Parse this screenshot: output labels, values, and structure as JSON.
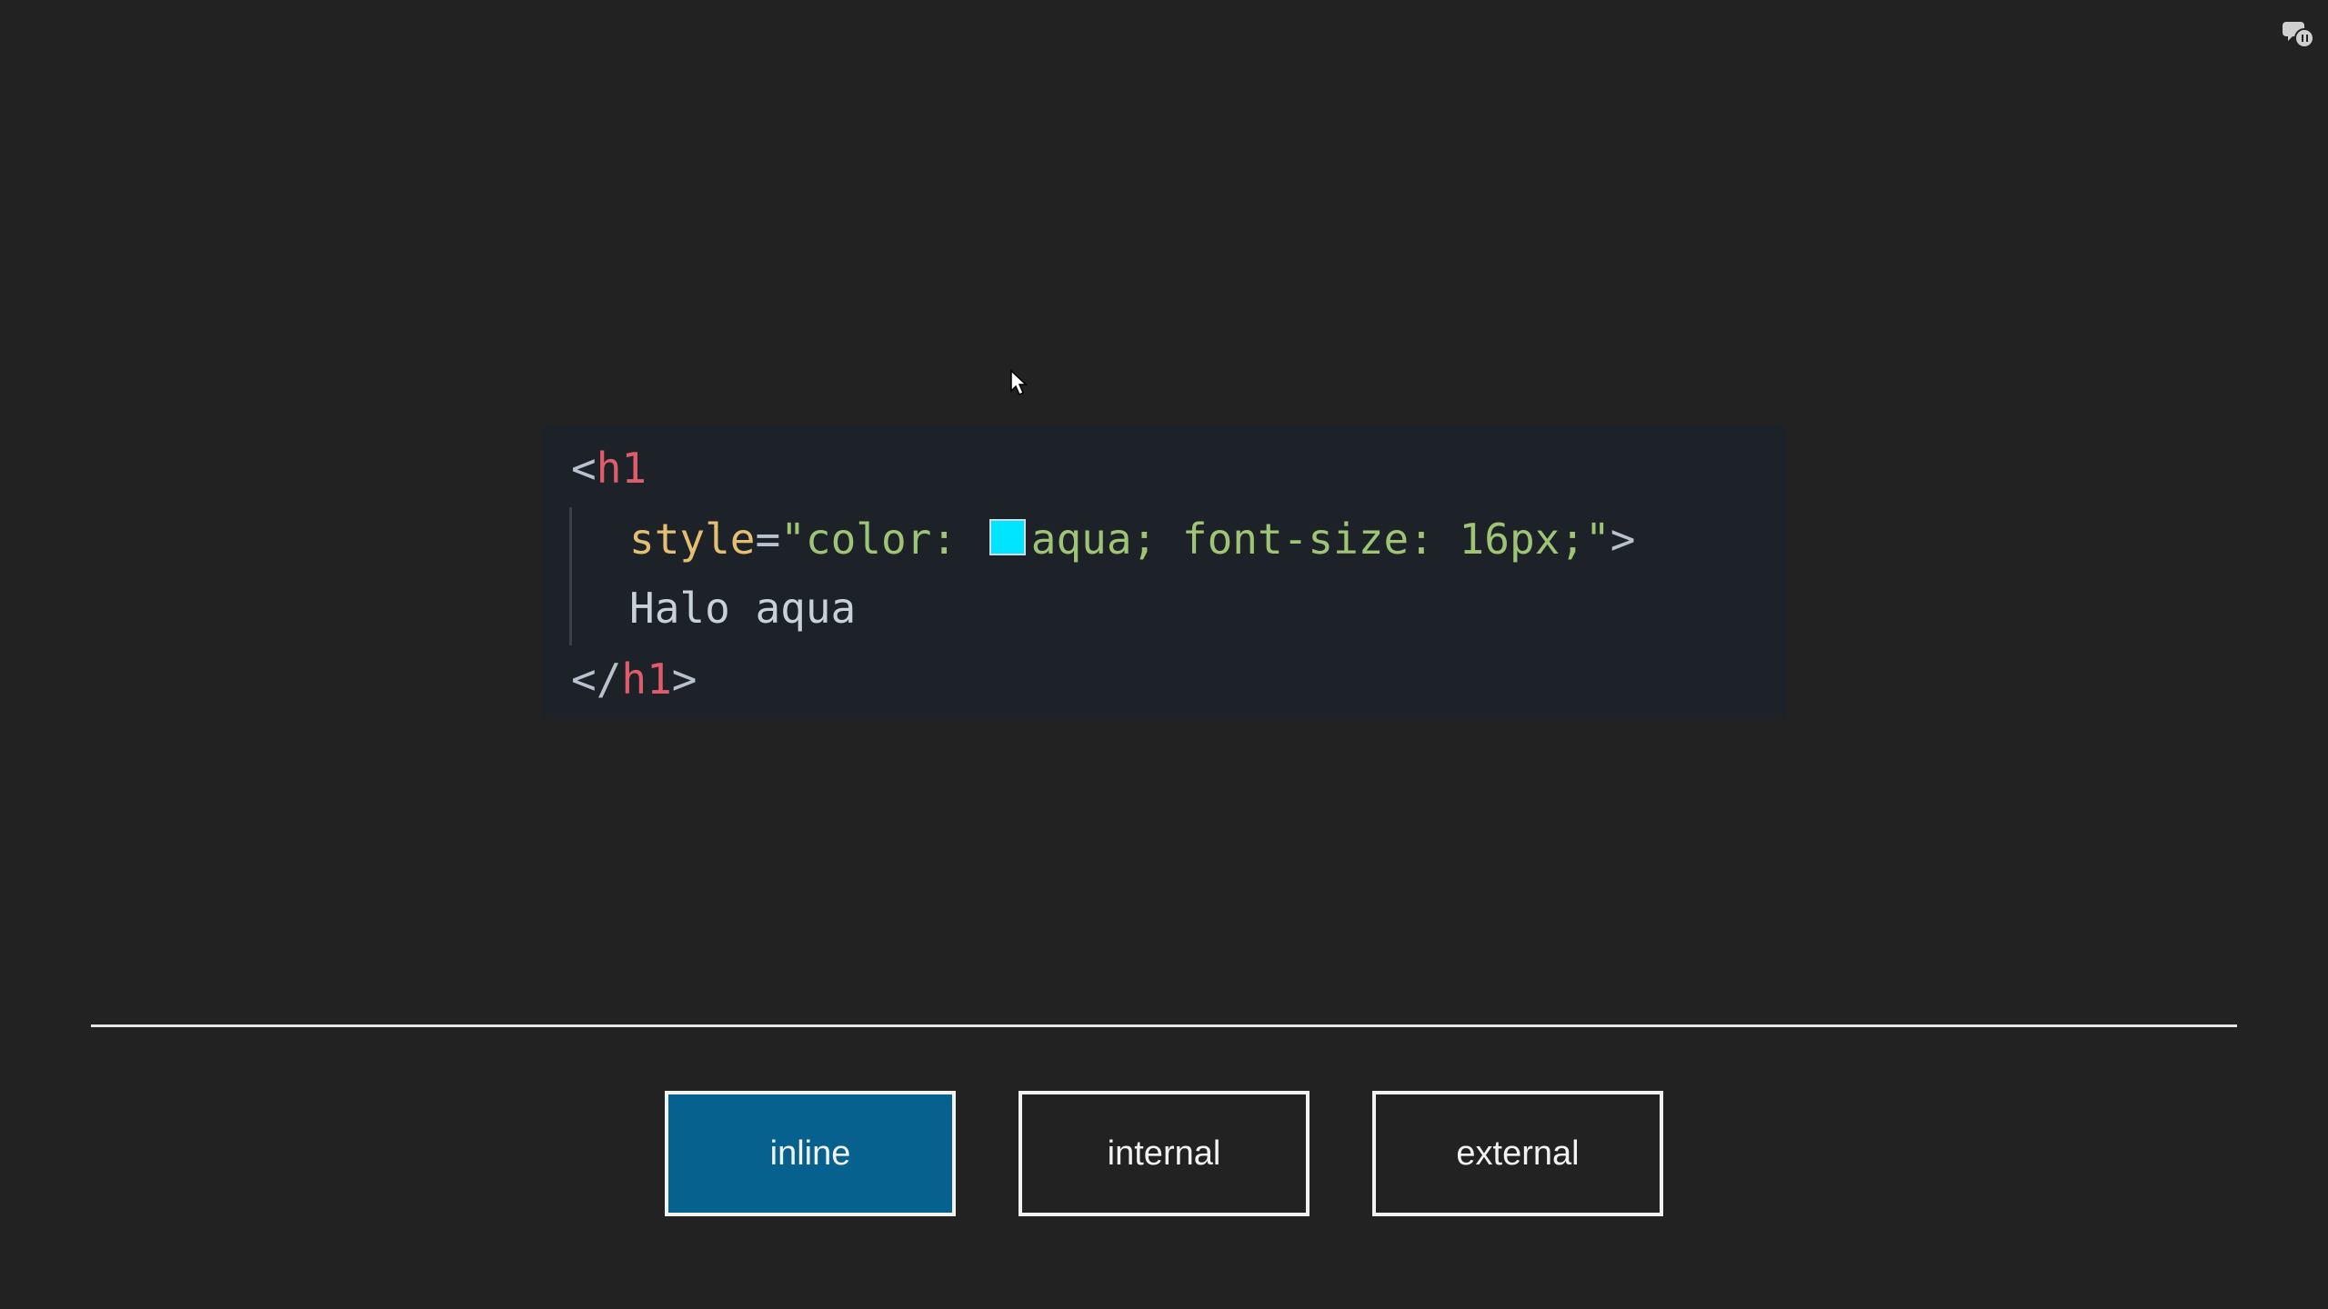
{
  "code": {
    "line1": {
      "open": "<",
      "tag": "h1"
    },
    "line2": {
      "attr": "style",
      "eq": "=",
      "value_start": "\"color: ",
      "value_rest": "aqua; font-size: 16px;\"",
      "close": ">"
    },
    "line3": {
      "text": "Halo aqua"
    },
    "line4": {
      "open": "</",
      "tag": "h1",
      "close": ">"
    },
    "swatch_color": "#00e5ff"
  },
  "tabs": [
    {
      "label": "inline",
      "active": true
    },
    {
      "label": "internal",
      "active": false
    },
    {
      "label": "external",
      "active": false
    }
  ],
  "colors": {
    "background": "#222222",
    "code_background": "#1c2228",
    "tag": "#e05c6c",
    "attribute": "#e4bf73",
    "string": "#9fc475",
    "active_tab": "#07618f"
  },
  "icons": {
    "corner": "chat-settings-icon",
    "cursor": "mouse-pointer-icon"
  }
}
